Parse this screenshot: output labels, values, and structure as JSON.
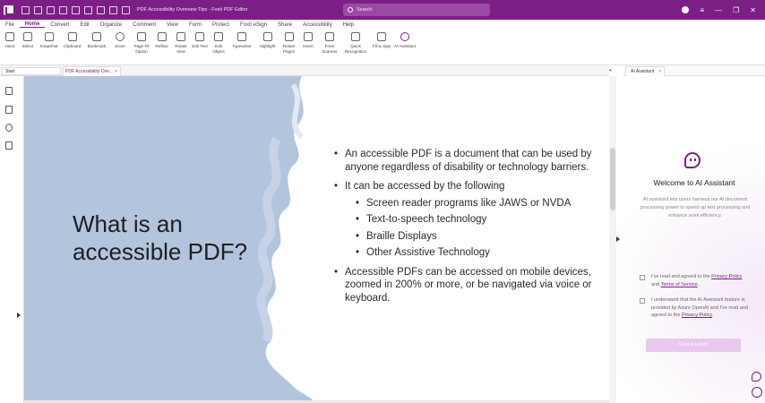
{
  "titlebar": {
    "title": "PDF Accessibility Overview Tips - Foxit PDF Editor",
    "search_placeholder": "Search"
  },
  "menu": [
    "File",
    "Home",
    "Convert",
    "Edit",
    "Organize",
    "Comment",
    "View",
    "Form",
    "Protect",
    "Foxit eSign",
    "Share",
    "Accessibility",
    "Help"
  ],
  "ribbon": {
    "hand": "Hand",
    "select": "Select",
    "snapshot": "SnapShot",
    "clipboard": "Clipboard",
    "bookmark": "Bookmark",
    "zoom": "Zoom",
    "page_fit": "Page Fit Option",
    "reflow": "Reflow",
    "rotate_view": "Rotate View",
    "edit_text": "Edit Text",
    "edit_object": "Edit Object",
    "typewriter": "Typewriter",
    "highlight": "Highlight",
    "rotate_pages": "Rotate Pages",
    "insert": "Insert",
    "from_scanner": "From Scanner",
    "quick_recognition": "Quick Recognition",
    "fill_sign": "Fill & Sign",
    "ai_assistant": "AI Assistant"
  },
  "tabs": {
    "start": "Start",
    "doc": "PDF Accessibility Ove...",
    "close": "×"
  },
  "slide": {
    "heading_line1": "What is an",
    "heading_line2": "accessible PDF?",
    "bullet1": "An accessible PDF is a document that can be used by anyone regardless of disability or technology barriers.",
    "bullet2": "It can be accessed by the following",
    "sub1": "Screen reader programs like JAWS or NVDA",
    "sub2": "Text-to-speech technology",
    "sub3": "Braille Displays",
    "sub4": "Other Assistive Technology",
    "bullet3": "Accessible PDFs can be accessed on mobile devices, zoomed in 200% or more, or be navigated via voice or keyboard."
  },
  "ai_panel": {
    "tab_label": "AI Assistant",
    "close": "×",
    "welcome": "Welcome to AI Assistant",
    "description": "AI assistant lets users harness our AI document processing power to speed up text processing and enhance work efficiency.",
    "agree1_prefix": "I've read and agreed to the",
    "agree1_privacy": "Privacy Policy",
    "agree1_and": "and",
    "agree1_terms": "Terms of Service",
    "agree2_text": "I understand that the AI Assistant feature is provided by Azure OpenAI and I've read and agreed to the",
    "agree2_privacy": "Privacy Policy",
    "chat_button": "Give it a shot"
  },
  "colors": {
    "brand": "#7c1f85",
    "slide_blue": "#b3c4dd"
  }
}
